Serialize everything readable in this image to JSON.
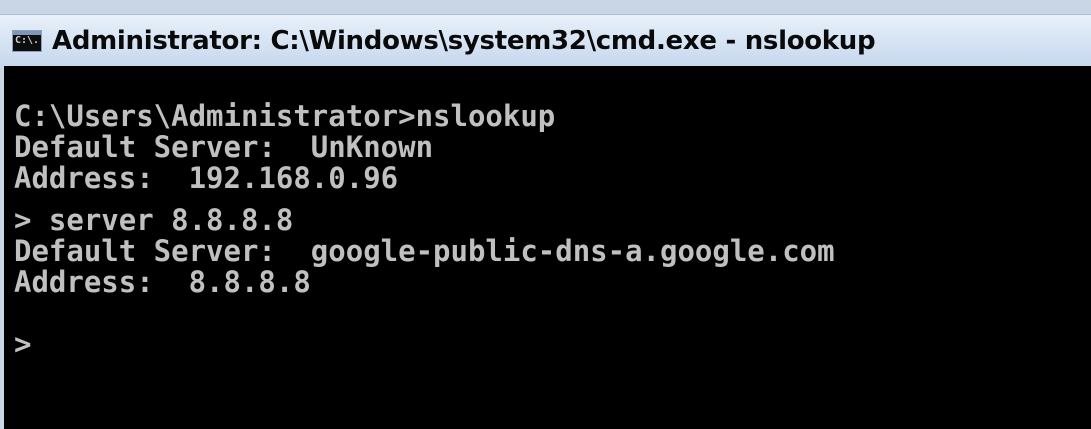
{
  "window": {
    "title": "Administrator: C:\\Windows\\system32\\cmd.exe - nslookup",
    "icon": "command-prompt-icon",
    "icon_glyph": "C:\\."
  },
  "console": {
    "lines": [
      "C:\\Users\\Administrator>nslookup",
      "Default Server:  UnKnown",
      "Address:  192.168.0.96",
      "> server 8.8.8.8",
      "Default Server:  google-public-dns-a.google.com",
      "Address:  8.8.8.8",
      ">"
    ]
  },
  "colors": {
    "console_background": "#000000",
    "console_text": "#c0c0c0",
    "titlebar": "#d8e5f4"
  }
}
